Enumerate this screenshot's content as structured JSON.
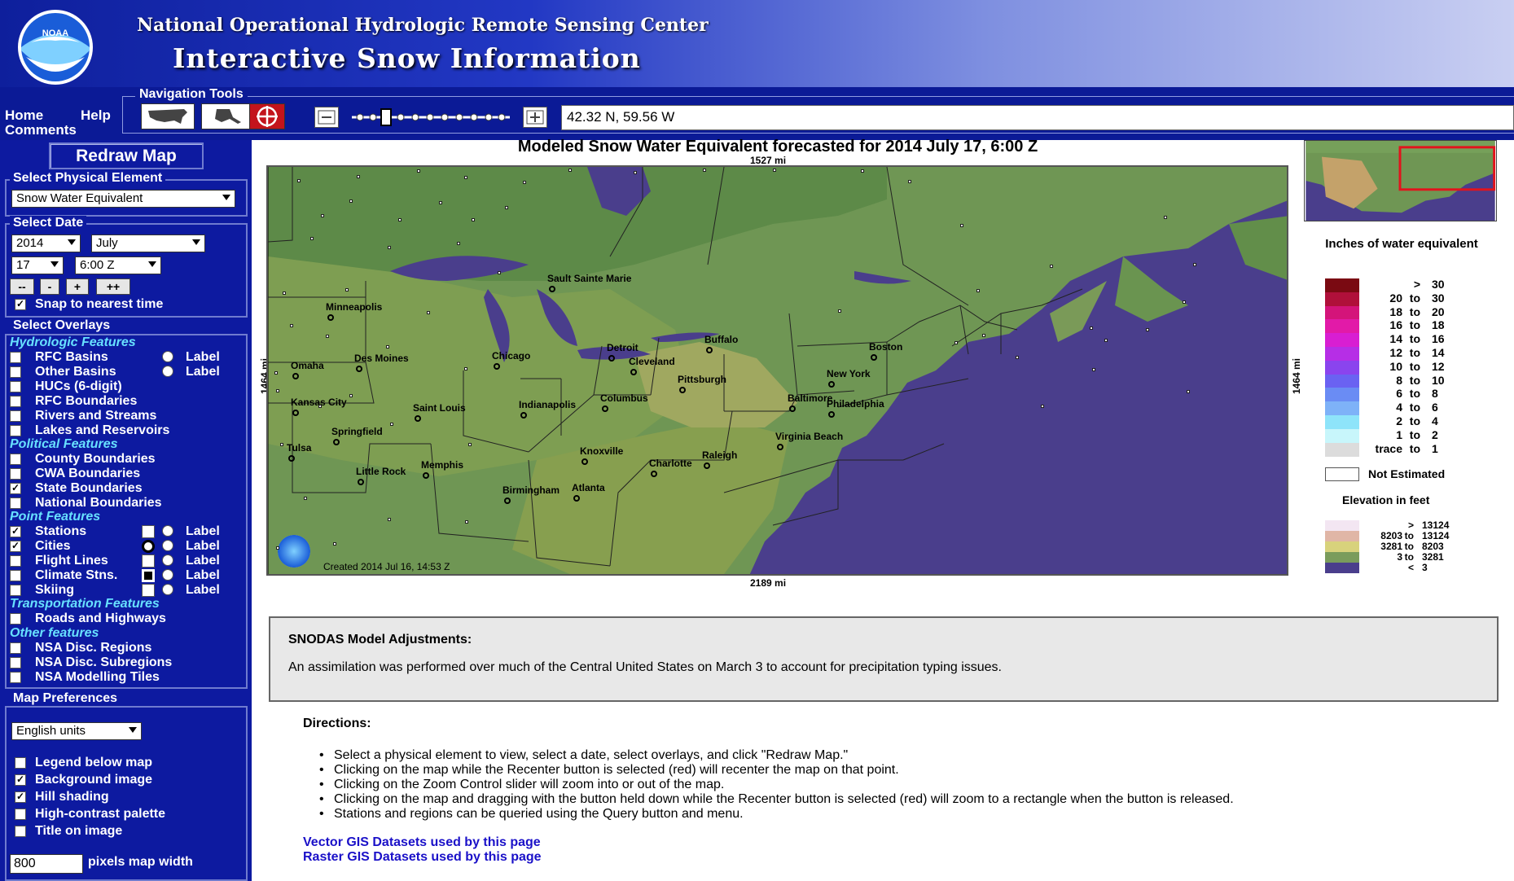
{
  "header": {
    "org": "National Operational Hydrologic Remote Sensing Center",
    "title": "Interactive Snow Information",
    "logo_text": "NOAA"
  },
  "nav": {
    "home": "Home",
    "help": "Help",
    "comments": "Comments",
    "tools_label": "Navigation Tools",
    "coords": "42.32 N, 59.56 W",
    "tool_selected": "recenter"
  },
  "sidebar": {
    "redraw": "Redraw Map",
    "physical": {
      "legend": "Select Physical Element",
      "value": "Snow Water Equivalent"
    },
    "date": {
      "legend": "Select Date",
      "year": "2014",
      "month": "July",
      "day": "17",
      "time": "6:00 Z",
      "buttons": [
        "--",
        "-",
        "+",
        "++"
      ],
      "snap": "Snap to nearest time"
    },
    "overlays": {
      "legend": "Select Overlays",
      "hydro_cat": "Hydrologic Features",
      "hydro": [
        "RFC Basins",
        "Other Basins",
        "HUCs (6-digit)",
        "RFC Boundaries",
        "Rivers and Streams",
        "Lakes and Reservoirs"
      ],
      "political_cat": "Political Features",
      "political": [
        "County Boundaries",
        "CWA Boundaries",
        "State Boundaries",
        "National Boundaries"
      ],
      "point_cat": "Point Features",
      "point": [
        "Stations",
        "Cities",
        "Flight Lines",
        "Climate Stns.",
        "Skiing"
      ],
      "transport_cat": "Transportation Features",
      "transport": [
        "Roads and Highways"
      ],
      "other_cat": "Other features",
      "other": [
        "NSA Disc. Regions",
        "NSA Disc. Subregions",
        "NSA Modelling Tiles"
      ],
      "label": "Label"
    },
    "prefs": {
      "legend": "Map Preferences",
      "units": "English units",
      "options": [
        "Legend below map",
        "Background image",
        "Hill shading",
        "High-contrast palette",
        "Title on image"
      ],
      "width_value": "800",
      "width_label": "pixels map width"
    }
  },
  "map": {
    "title": "Modeled Snow Water Equivalent forecasted for 2014 July 17, 6:00 Z",
    "top_scale": "1527 mi",
    "bottom_scale": "2189 mi",
    "side_scale": "1464 mi",
    "created": "Created 2014 Jul 16, 14:53 Z",
    "cities": [
      "Sault Sainte Marie",
      "Minneapolis",
      "Detroit",
      "Buffalo",
      "Boston",
      "Chicago",
      "Cleveland",
      "Des Moines",
      "Omaha",
      "Pittsburgh",
      "New York",
      "Kansas City",
      "Saint Louis",
      "Indianapolis",
      "Columbus",
      "Baltimore",
      "Philadelphia",
      "Springfield",
      "Virginia Beach",
      "Tulsa",
      "Knoxville",
      "Raleigh",
      "Memphis",
      "Charlotte",
      "Little Rock",
      "Atlanta",
      "Birmingham"
    ]
  },
  "legend": {
    "swe_title": "Inches of water equivalent",
    "swe_rows": [
      {
        "a": "",
        "b": ">",
        "c": "30",
        "color": "#7a0a12"
      },
      {
        "a": "20",
        "b": "to",
        "c": "30",
        "color": "#b0103a"
      },
      {
        "a": "18",
        "b": "to",
        "c": "20",
        "color": "#d4147a"
      },
      {
        "a": "16",
        "b": "to",
        "c": "18",
        "color": "#e21aa8"
      },
      {
        "a": "14",
        "b": "to",
        "c": "16",
        "color": "#d81ed2"
      },
      {
        "a": "12",
        "b": "to",
        "c": "14",
        "color": "#b62ee6"
      },
      {
        "a": "10",
        "b": "to",
        "c": "12",
        "color": "#8a44ee"
      },
      {
        "a": "8",
        "b": "to",
        "c": "10",
        "color": "#6a62f2"
      },
      {
        "a": "6",
        "b": "to",
        "c": "8",
        "color": "#6a8cf4"
      },
      {
        "a": "4",
        "b": "to",
        "c": "6",
        "color": "#7eb2f8"
      },
      {
        "a": "2",
        "b": "to",
        "c": "4",
        "color": "#8ee4fa"
      },
      {
        "a": "1",
        "b": "to",
        "c": "2",
        "color": "#c8f6fb"
      },
      {
        "a": "trace",
        "b": "to",
        "c": "1",
        "color": "#dcdcdc"
      }
    ],
    "not_estimated": "Not Estimated",
    "elev_title": "Elevation in feet",
    "elev_rows": [
      {
        "a": "",
        "b": ">",
        "c": "13124",
        "color": "#f3e6f2"
      },
      {
        "a": "8203",
        "b": "to",
        "c": "13124",
        "color": "#e0b6a6"
      },
      {
        "a": "3281",
        "b": "to",
        "c": "8203",
        "color": "#d8d27c"
      },
      {
        "a": "3",
        "b": "to",
        "c": "3281",
        "color": "#7a9c5c"
      },
      {
        "a": "",
        "b": "<",
        "c": "3",
        "color": "#4a3e8c"
      }
    ]
  },
  "snodas": {
    "title": "SNODAS Model Adjustments:",
    "text": "An assimilation was performed over much of the Central United States on March 3 to account for precipitation typing issues."
  },
  "directions": {
    "title": "Directions:",
    "items": [
      "Select a physical element to view, select a date, select overlays, and click \"Redraw Map.\"",
      "Clicking on the map while the Recenter button is selected (red) will recenter the map on that point.",
      "Clicking on the Zoom Control slider will zoom into or out of the map.",
      "Clicking on the map and dragging with the button held down while the Recenter button is selected (red) will zoom to a rectangle when the button is released.",
      "Stations and regions can be queried using the Query button and menu."
    ],
    "links": [
      "Vector GIS Datasets used by this page",
      "Raster GIS Datasets used by this page"
    ]
  }
}
